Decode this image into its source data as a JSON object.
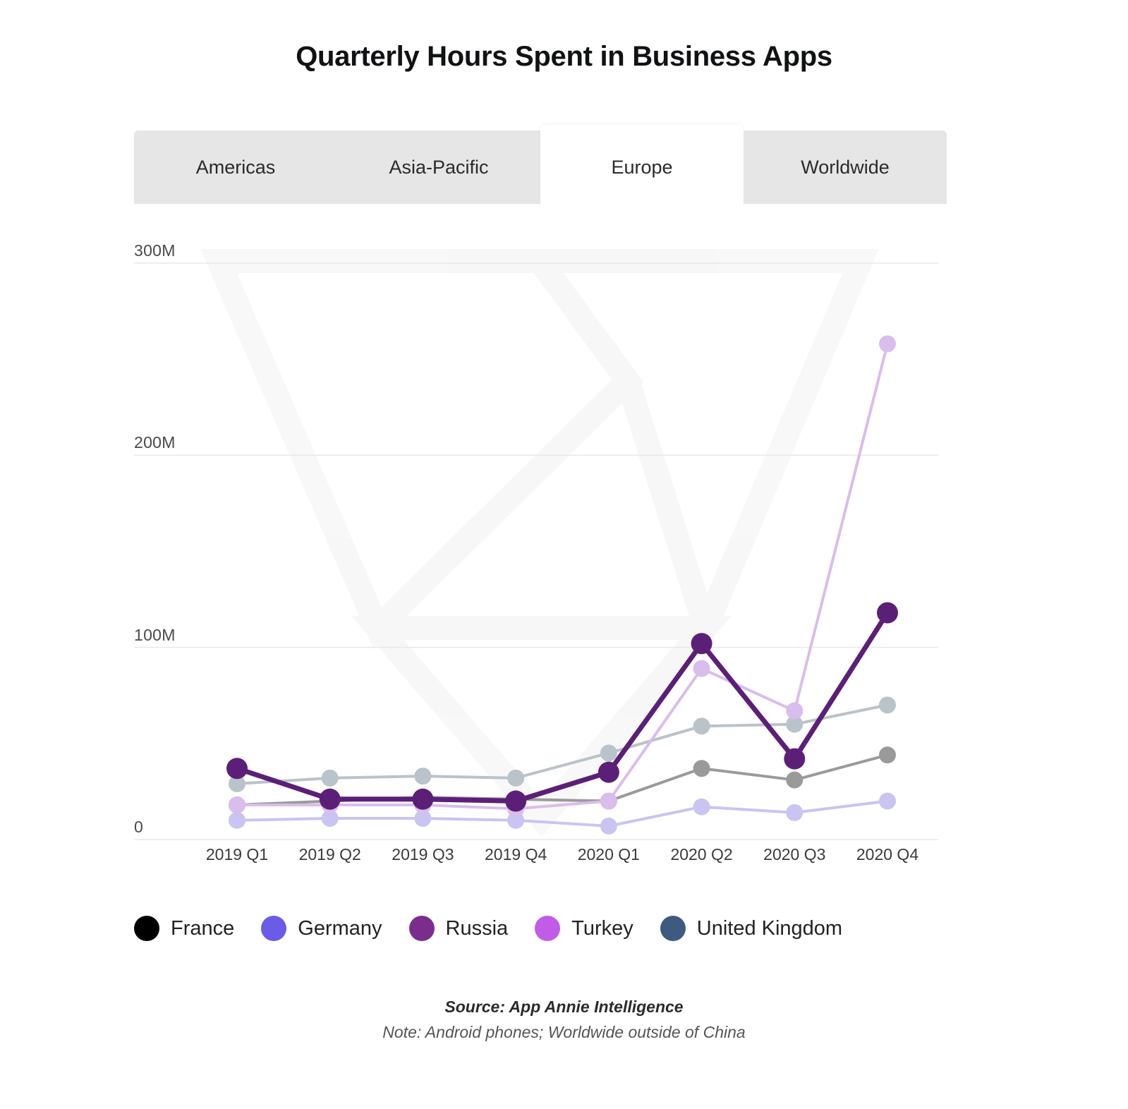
{
  "header": {
    "title": "Quarterly Hours Spent in Business Apps"
  },
  "tabs": [
    {
      "label": "Americas",
      "active": false
    },
    {
      "label": "Asia-Pacific",
      "active": false
    },
    {
      "label": "Europe",
      "active": true
    },
    {
      "label": "Worldwide",
      "active": false
    }
  ],
  "footer": {
    "source": "Source: App Annie Intelligence",
    "note": "Note: Android phones; Worldwide outside of China"
  },
  "chart_data": {
    "type": "line",
    "title": "Quarterly Hours Spent in Business Apps",
    "xlabel": "",
    "ylabel": "",
    "ylim": [
      0,
      300000000
    ],
    "ytick_labels": [
      "0",
      "100M",
      "200M",
      "300M"
    ],
    "ytick_values": [
      0,
      100000000,
      200000000,
      300000000
    ],
    "grid": true,
    "legend_position": "bottom",
    "categories": [
      "2019 Q1",
      "2019 Q2",
      "2019 Q3",
      "2019 Q4",
      "2020 Q1",
      "2020 Q2",
      "2020 Q3",
      "2020 Q4"
    ],
    "units": "hours",
    "series": [
      {
        "name": "France",
        "color": "#000000",
        "render_color": "#9a9a9a",
        "values": [
          18000000,
          20000000,
          22000000,
          21000000,
          20000000,
          37000000,
          31000000,
          44000000
        ]
      },
      {
        "name": "Germany",
        "color": "#6b5ce7",
        "render_color": "#c9c4f2",
        "values": [
          10000000,
          11000000,
          11000000,
          10000000,
          7000000,
          17000000,
          14000000,
          20000000
        ]
      },
      {
        "name": "Russia",
        "color": "#7b2d8e",
        "render_color": "#5c1f78",
        "values": [
          37000000,
          21000000,
          21000000,
          20000000,
          35000000,
          102000000,
          42000000,
          118000000
        ]
      },
      {
        "name": "Turkey",
        "color": "#c05ce8",
        "render_color": "#d9bdec",
        "values": [
          18000000,
          18000000,
          18000000,
          16000000,
          20000000,
          89000000,
          67000000,
          258000000
        ]
      },
      {
        "name": "United Kingdom",
        "color": "#3d5a80",
        "render_color": "#b9c3c9",
        "values": [
          29000000,
          32000000,
          33000000,
          32000000,
          45000000,
          59000000,
          60000000,
          70000000
        ]
      }
    ]
  }
}
